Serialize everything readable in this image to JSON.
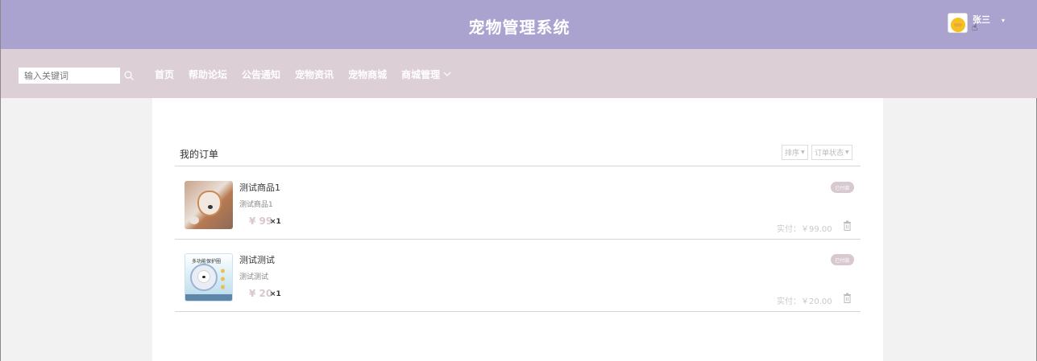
{
  "header": {
    "title": "宠物管理系统",
    "user_name": "张三",
    "user_caret": "▾"
  },
  "nav": {
    "search_placeholder": "输入关键词",
    "items": [
      {
        "label": "首页"
      },
      {
        "label": "帮助论坛"
      },
      {
        "label": "公告通知"
      },
      {
        "label": "宠物资讯"
      },
      {
        "label": "宠物商城"
      },
      {
        "label": "商城管理"
      }
    ]
  },
  "orders": {
    "title": "我的订单",
    "sort_label": "排序",
    "status_filter_label": "订单状态",
    "items": [
      {
        "name": "测试商品1",
        "desc": "测试商品1",
        "price": "¥ 99",
        "qty": "×1",
        "status": "已付款",
        "paid": "实付：￥99.00"
      },
      {
        "name": "测试测试",
        "desc": "测试测试",
        "price": "¥ 20",
        "qty": "×1",
        "status": "已付款",
        "paid": "实付：￥20.00",
        "image_banner": "多功能保护圈"
      }
    ]
  },
  "colors": {
    "header_bg": "#aaa3cf",
    "nav_bg": "#dccfd5",
    "accent_price": "#d9c7cd"
  }
}
